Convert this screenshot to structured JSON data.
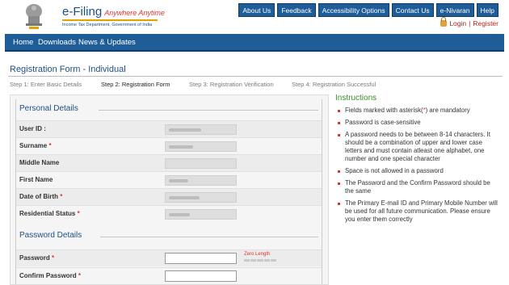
{
  "brand": {
    "title": "e-Filing",
    "tagline": "Anywhere Anytime",
    "subtitle": "Income Tax Department, Government of India"
  },
  "top_nav": [
    "About Us",
    "Feedback",
    "Accessibility Options",
    "Contact Us",
    "e-Nivaran",
    "Help"
  ],
  "account": {
    "login": "Login",
    "separator": "|",
    "register": "Register"
  },
  "main_nav": [
    "Home",
    "Downloads",
    "News & Updates"
  ],
  "form": {
    "title": "Registration Form - Individual",
    "steps": [
      "Step 1: Enter Basic Details",
      "Step 2: Registration Form",
      "Step 3: Registration Verification",
      "Step 4: Registration Successful"
    ],
    "active_step": 2,
    "personal_details": {
      "heading": "Personal Details",
      "fields": [
        {
          "label": "User ID :",
          "required": false
        },
        {
          "label": "Surname",
          "required": true
        },
        {
          "label": "Middle Name",
          "required": false
        },
        {
          "label": "First Name",
          "required": false
        },
        {
          "label": "Date of Birth",
          "required": true
        },
        {
          "label": "Residential Status",
          "required": true
        }
      ]
    },
    "password_details": {
      "heading": "Password Details",
      "password_label": "Password",
      "confirm_label": "Confirm Password",
      "strength_text": "Zero Length"
    },
    "required_mark": "*"
  },
  "instructions": {
    "heading": "Instructions",
    "items": [
      "Fields marked with asterisk(*) are mandatory",
      "Password is case-sensitive",
      "A password needs to be between 8-14 characters. It should be a combination of upper and lower case letters and must contain atleast one alphabet, one number and one special character",
      "Space is not allowed in a password",
      "The Password and the Confirm Password should be the same",
      "The Primary E-mail ID and Primary Mobile Number will be used for all future communication. Please ensure you enter them correctly"
    ]
  },
  "colors": {
    "brand_blue": "#1f5d99",
    "accent_red": "#d33333",
    "instruction_green": "#3c8a2e"
  }
}
